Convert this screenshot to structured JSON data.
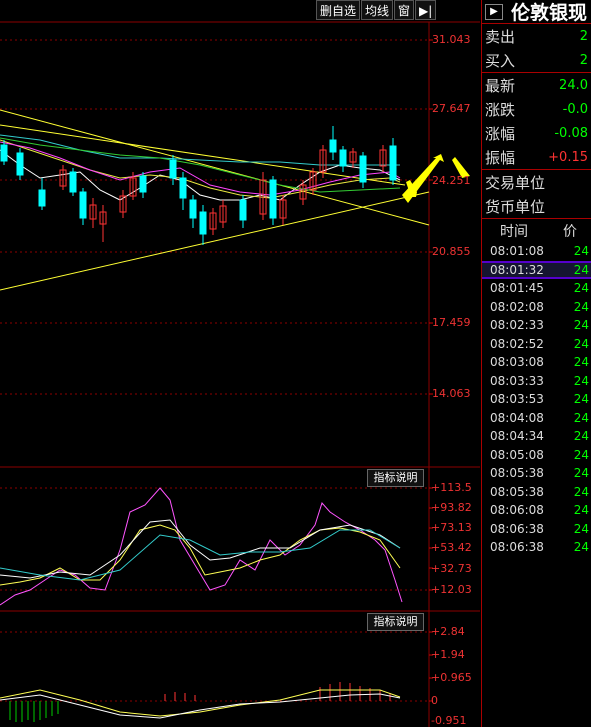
{
  "toolbar": {
    "delete_watch": "删自选",
    "ma_line": "均线",
    "window": "窗",
    "collapse_icon": "play-collapse-icon"
  },
  "price_axis": [
    "31.043",
    "27.647",
    "24.251",
    "20.855",
    "17.459",
    "14.063"
  ],
  "indicator1": {
    "button": "指标说明",
    "axis": [
      "+113.5",
      "+93.82",
      "+73.13",
      "+53.42",
      "+32.73",
      "+12.03"
    ]
  },
  "indicator2": {
    "button": "指标说明",
    "axis": [
      "+2.84",
      "+1.94",
      "+0.965",
      "0",
      "-0.951"
    ]
  },
  "side": {
    "title": "伦敦银现",
    "sell_label": "卖出",
    "sell_value": "2",
    "buy_label": "买入",
    "buy_value": "2",
    "latest_label": "最新",
    "latest_value": "24.0",
    "change_label": "涨跌",
    "change_value": "-0.0",
    "pct_label": "涨幅",
    "pct_value": "-0.08",
    "amp_label": "振幅",
    "amp_value": "+0.15",
    "trade_unit_label": "交易单位",
    "currency_unit_label": "货币单位",
    "time_header": "时间",
    "price_header": "价",
    "ticks": [
      {
        "time": "08:01:08",
        "price": "24"
      },
      {
        "time": "08:01:32",
        "price": "24"
      },
      {
        "time": "08:01:45",
        "price": "24"
      },
      {
        "time": "08:02:08",
        "price": "24"
      },
      {
        "time": "08:02:33",
        "price": "24"
      },
      {
        "time": "08:02:52",
        "price": "24"
      },
      {
        "time": "08:03:08",
        "price": "24"
      },
      {
        "time": "08:03:33",
        "price": "24"
      },
      {
        "time": "08:03:53",
        "price": "24"
      },
      {
        "time": "08:04:08",
        "price": "24"
      },
      {
        "time": "08:04:34",
        "price": "24"
      },
      {
        "time": "08:05:08",
        "price": "24"
      },
      {
        "time": "08:05:38",
        "price": "24"
      },
      {
        "time": "08:05:38",
        "price": "24"
      },
      {
        "time": "08:06:08",
        "price": "24"
      },
      {
        "time": "08:06:38",
        "price": "24"
      },
      {
        "time": "08:06:38",
        "price": "24"
      }
    ]
  },
  "colors": {
    "up": "#ff3333",
    "down": "#00ffff",
    "grid": "#8b0000",
    "trend": "#ffff33",
    "annotation": "#ffff00"
  }
}
